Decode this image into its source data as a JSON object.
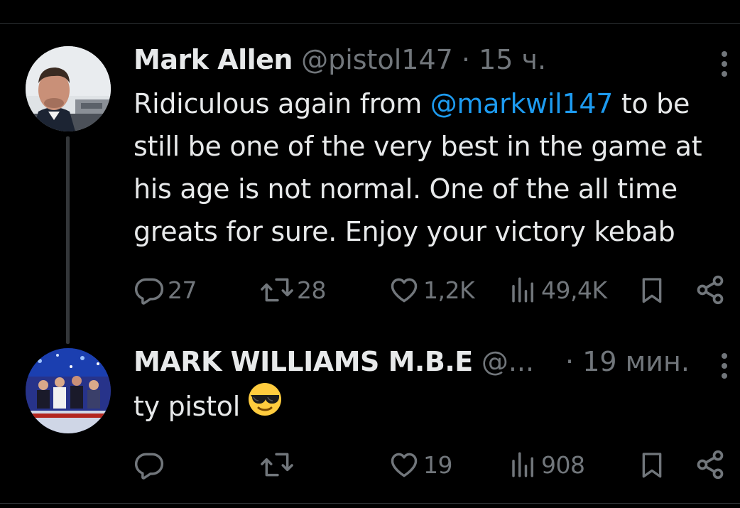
{
  "tweets": [
    {
      "name": "Mark Allen",
      "handle": "@pistol147",
      "separator": "·",
      "time": "15 ч.",
      "text_before": "Ridiculous again from ",
      "mention": "@markwil147",
      "text_after": " to be still be one of the very best in the game at his age is not normal. One of the all time greats for sure. Enjoy your victory kebab",
      "replies": "27",
      "retweets": "28",
      "likes": "1,2K",
      "views": "49,4K"
    },
    {
      "name": "MARK WILLIAMS M.B.E",
      "handle": "@...",
      "separator": "·",
      "time": "19 мин.",
      "text": "ty pistol",
      "emoji": "smiling-face-with-sunglasses",
      "replies": "",
      "retweets": "",
      "likes": "19",
      "views": "908"
    }
  ],
  "colors": {
    "background": "#000000",
    "text": "#e7e9ea",
    "secondary": "#71767b",
    "link": "#1d9bf0",
    "divider": "#2f3336"
  }
}
